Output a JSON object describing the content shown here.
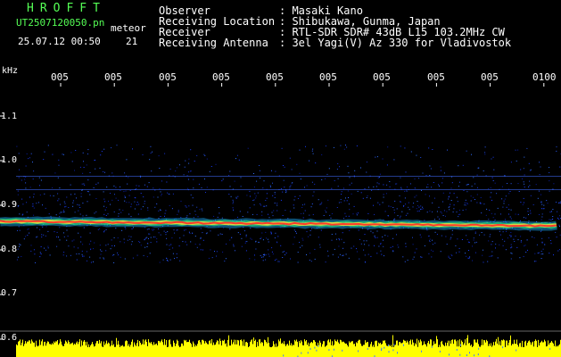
{
  "header": {
    "title": "HROFFT",
    "filename": "UT2507120050.pn",
    "type": "meteor",
    "datetime": "25.07.12 00:50",
    "count": "21"
  },
  "info": [
    {
      "label": "Observer",
      "value": ": Masaki Kano"
    },
    {
      "label": "Receiving Location",
      "value": ": Shibukawa, Gunma, Japan"
    },
    {
      "label": "Receiver",
      "value": ": RTL-SDR SDR# 43dB L15 103.2MHz CW"
    },
    {
      "label": "Receiving Antenna",
      "value": ": 3el Yagi(V) Az 330 for Vladivostok"
    }
  ],
  "axes": {
    "freq_unit": "kHz",
    "freq_ticks": [
      "1.1",
      "1.0",
      "0.9",
      "0.8",
      "0.7",
      "0.6"
    ],
    "time_ticks": [
      "005",
      "005",
      "005",
      "005",
      "005",
      "005",
      "005",
      "005",
      "005",
      "0100"
    ]
  },
  "colors": {
    "label_green": "#55ff55",
    "text": "#ffffff",
    "signal_band": "#ff3b2a",
    "noise_blue": "#1a3cff",
    "power_bar": "#ffff00"
  },
  "chart_data": {
    "type": "heatmap",
    "title": "",
    "xlabel": "",
    "ylabel": "kHz",
    "ylim": [
      0.58,
      1.2
    ],
    "signal_band_center_khz": 0.86,
    "noise_band_khz": [
      0.78,
      1.02
    ],
    "grid": false,
    "legend": "none"
  }
}
